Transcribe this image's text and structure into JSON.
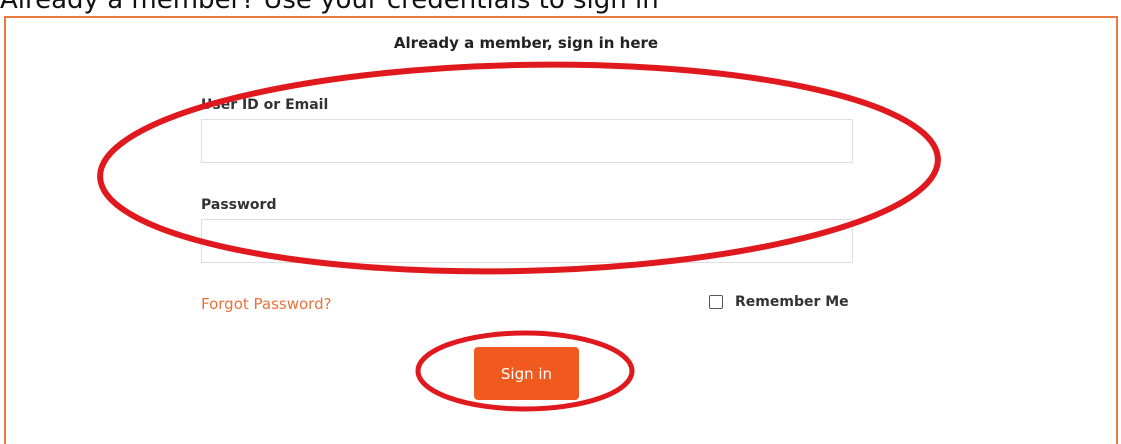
{
  "caption": "Already a member? Use your credentials to sign in",
  "form": {
    "title": "Already a member, sign in here",
    "user_label": "User ID or Email",
    "user_value": "",
    "user_placeholder": "",
    "password_label": "Password",
    "password_value": "",
    "password_placeholder": "",
    "forgot_link": "Forgot Password?",
    "remember_label": "Remember Me",
    "remember_checked": false,
    "submit_label": "Sign in"
  },
  "colors": {
    "accent": "#f05a1e",
    "link": "#e8713a",
    "frame_border": "#e87a3d",
    "annotation": "#e0191e"
  }
}
